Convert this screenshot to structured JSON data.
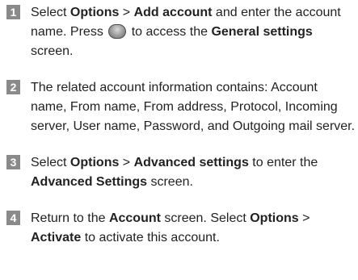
{
  "steps": [
    {
      "number": "1",
      "t1": "Select ",
      "b1": "Options",
      "t2": " > ",
      "b2": "Add account",
      "t3": " and enter the account name. Press ",
      "icon": "ok-key-icon",
      "t4": " to access the ",
      "b3": "General settings",
      "t5": " screen."
    },
    {
      "number": "2",
      "t1": "The related account information contains: Account name, From name, From address, Protocol, Incoming server, User name, Password, and Outgoing mail server."
    },
    {
      "number": "3",
      "t1": "Select ",
      "b1": "Options",
      "t2": " > ",
      "b2": "Advanced settings",
      "t3": " to enter the ",
      "b3": "Advanced Settings",
      "t4": " screen."
    },
    {
      "number": "4",
      "t1": "Return to the ",
      "b1": "Account",
      "t2": " screen. Select ",
      "b2": "Options",
      "t3": " > ",
      "b3": "Activate",
      "t4": " to activate this account."
    }
  ]
}
